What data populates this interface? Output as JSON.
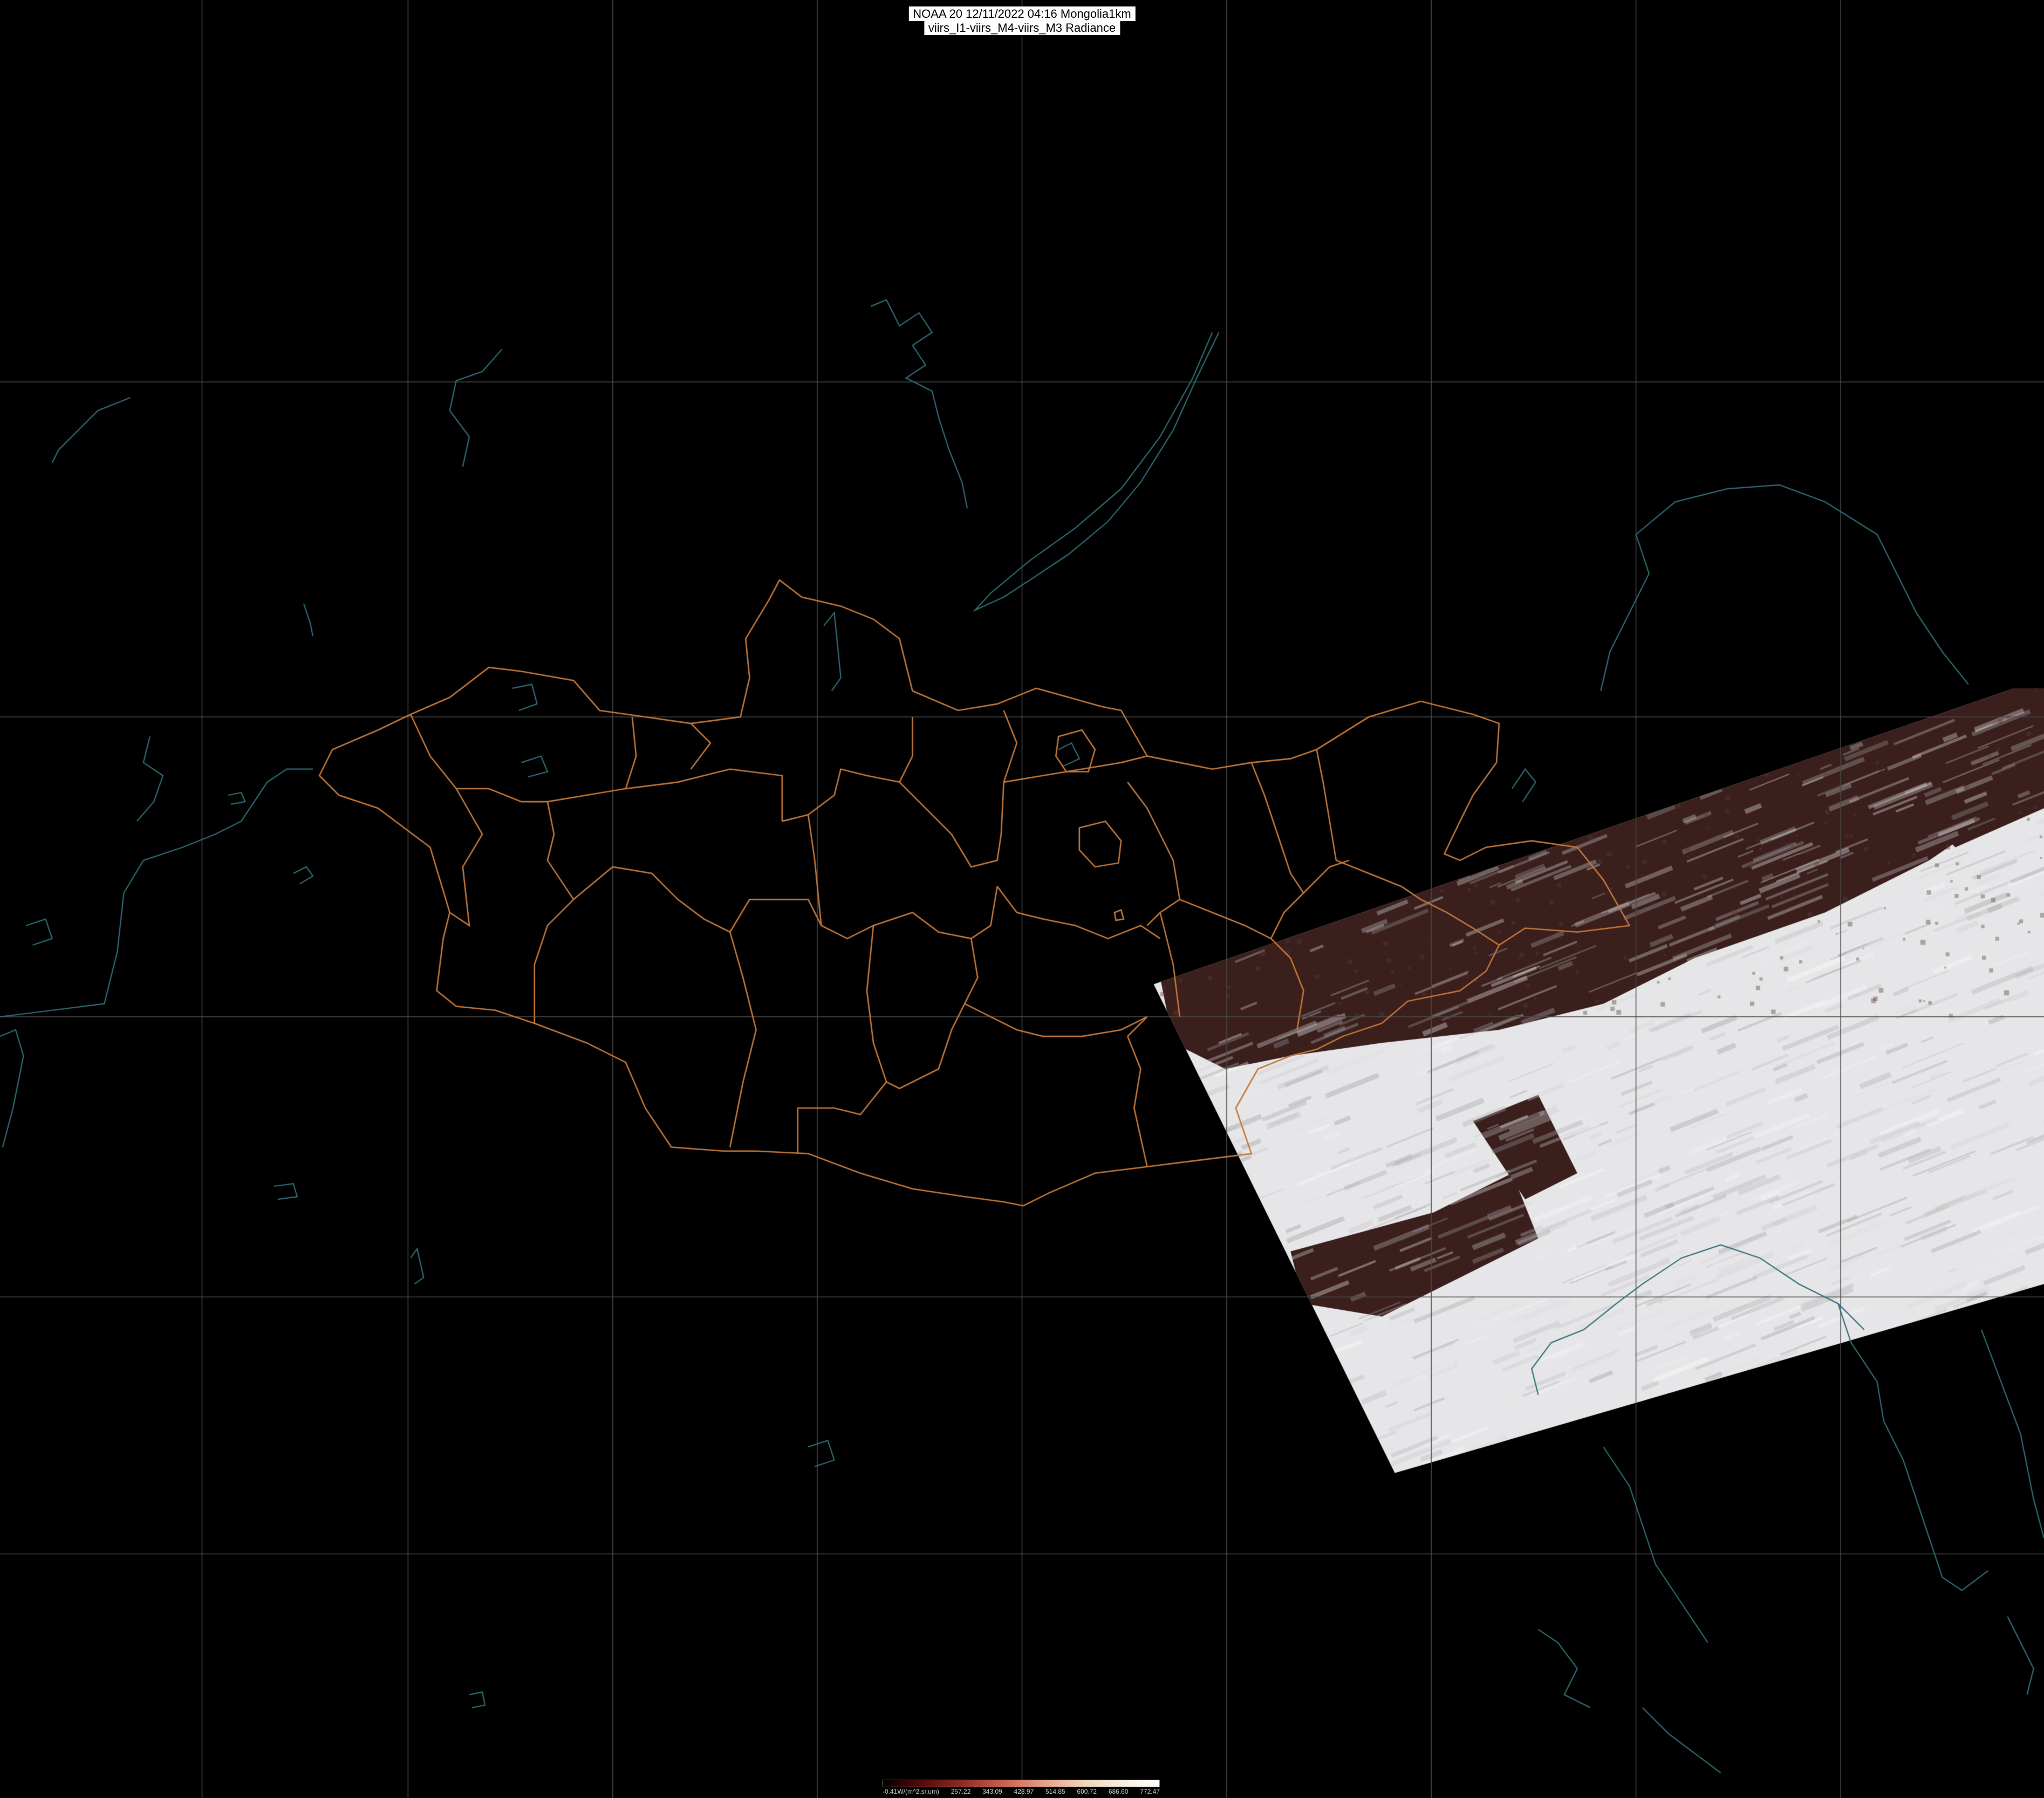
{
  "header": {
    "title_line_1": "NOAA 20 12/11/2022 04:16 Mongolia1km",
    "title_line_2": "viirs_I1-viirs_M4-viirs_M3 Radiance"
  },
  "legend": {
    "unit_label": "-0.41W/(m^2.sr.um)",
    "tick_labels": [
      "257.22",
      "343.09",
      "428.97",
      "514.85",
      "600.72",
      "686.60",
      "772.47"
    ],
    "gradient_colors": [
      "#000000",
      "#5c0f0d",
      "#b84a3d",
      "#e49d86",
      "#f3dfca",
      "#ffffff"
    ]
  },
  "map": {
    "background_color": "#000000",
    "graticule_color": "#4a4a4a",
    "country_border_color": "#c4783a",
    "coastline_color": "#2f6f78",
    "swath_cloud_color": "#e6e6e8",
    "swath_ground_color": "#3a1f1c",
    "layers": [
      "graticule",
      "country-borders",
      "province-borders",
      "coastlines-lakes",
      "satellite-swath"
    ]
  }
}
